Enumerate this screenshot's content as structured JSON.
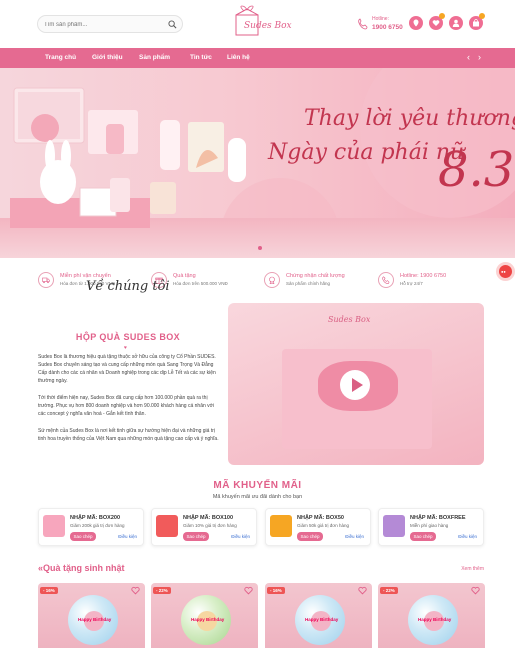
{
  "header": {
    "search_placeholder": "Tìm sản phẩm...",
    "logo_text": "Sudes Box",
    "hotline_label": "Hotline:",
    "hotline_number": "1900 6750"
  },
  "nav": {
    "items": [
      "Trang chủ",
      "Giới thiệu",
      "Sản phẩm",
      "Tin tức",
      "Liên hệ"
    ],
    "dropdown_icon": "chevron-down-icon"
  },
  "banner": {
    "line1": "Thay lời yêu thương",
    "line2": "Ngày của phái nữ",
    "number": "8.3"
  },
  "features": [
    {
      "title": "Miễn phí vận chuyển",
      "sub": "Hóa đơn từ 1.000.000 VNĐ",
      "icon": "truck-icon"
    },
    {
      "title": "Quà tặng",
      "sub": "Hóa đơn trên 500.000 VNĐ",
      "icon": "gift-icon"
    },
    {
      "title": "Chứng nhận chất lượng",
      "sub": "Sản phẩm chính hãng",
      "icon": "badge-icon"
    },
    {
      "title": "Hotline: 1900 6750",
      "sub": "Hỗ trợ 24/7",
      "icon": "phone-icon"
    }
  ],
  "about": {
    "heading": "Về chúng tôi",
    "title": "HỘP QUÀ SUDES BOX",
    "p1": "Sudes Box là thương hiệu quà tặng thuộc sở hữu của công ty Cổ Phần SUDES. Sudes Box chuyên sáng tạo và cung cấp những món quà Sang Trọng Và Đẳng Cấp dành cho các cá nhân và Doanh nghiệp trong các dịp Lễ Tết và các sự kiện thường ngày.",
    "p2": "Tới thời điểm hiện nay, Sudes Box đã cung cấp hơn 100.000 phần quà ra thị trường. Phục vụ hơn 800 doanh nghiệp và hơn 90.000 khách hàng cá nhân với các concept ý nghĩa văn hoá - Gắn kết tình thân.",
    "p3": "Sứ mệnh của Sudes Box là nơi kết tinh giữa sự hướng hiện đại và những giá trị tinh hoa truyền thống của Việt Nam qua những món quà tặng cao cấp và ý nghĩa.",
    "video_logo": "Sudes Box"
  },
  "promo": {
    "title": "MÃ KHUYẾN MÃI",
    "subtitle": "Mã khuyến mãi ưu đãi dành cho bạn",
    "copy_label": "Sao chép",
    "link_label": "Điều kiện",
    "coupons": [
      {
        "code": "NHẬP MÃ: BOX200",
        "desc": "Giảm 200k giá trị đơn hàng",
        "color": "#f7a6bd"
      },
      {
        "code": "NHẬP MÃ: BOX100",
        "desc": "Giảm 10% giá trị đơn hàng",
        "color": "#f15b5b"
      },
      {
        "code": "NHẬP MÃ: BOX50",
        "desc": "Giảm 50k giá trị đơn hàng",
        "color": "#f6a623"
      },
      {
        "code": "NHẬP MÃ: BOXFREE",
        "desc": "Miễn phí giao hàng",
        "color": "#b48ad6"
      }
    ]
  },
  "products": {
    "section_title": "Quà tặng sinh nhật",
    "see_more": "Xem thêm",
    "items": [
      {
        "discount": "- 16%",
        "label": "Happy Birthday"
      },
      {
        "discount": "- 22%",
        "label": "Happy Birthday"
      },
      {
        "discount": "- 16%",
        "label": "Happy Birthday"
      },
      {
        "discount": "- 22%",
        "label": "Happy Birthday"
      }
    ]
  },
  "colors": {
    "brand": "#e56a91",
    "accent": "#e1608a",
    "headline": "#c2354f"
  }
}
